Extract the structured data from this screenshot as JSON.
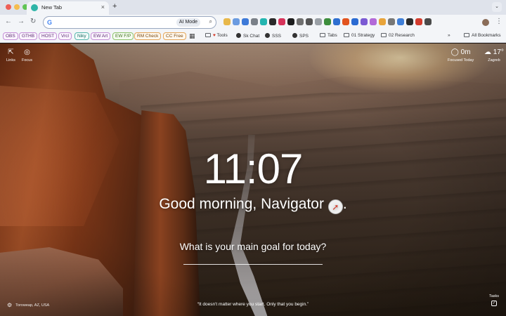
{
  "browser": {
    "tab_title": "New Tab",
    "tab_close": "×",
    "new_tab": "+",
    "tab_menu": "⌄",
    "nav_back": "←",
    "nav_forward": "→",
    "nav_reload": "↻",
    "omnibox_badge": "G",
    "ai_mode": "AI Mode",
    "omnibox_placeholder": "",
    "kebab": "⋮"
  },
  "bookmarks": {
    "chips": [
      "OBS",
      "GTHB",
      "HOST",
      "Vrcl",
      "Niky",
      "EW Art",
      "EW F/P",
      "RM Check",
      "CC Free"
    ],
    "items": [
      "Tools",
      "Sk Chat",
      "SSS",
      "SPS",
      "Tabs",
      "01 Strategy",
      "02 Research"
    ],
    "overflow": "»",
    "all_bookmarks": "All Bookmarks",
    "apps_glyph": "▦"
  },
  "dashboard": {
    "links_label": "Links",
    "focus_label": "Focus",
    "focused_today_value": "0m",
    "focused_today_label": "Focused Today",
    "weather_temp": "17°",
    "weather_city": "Zagreb",
    "clock": "11:07",
    "greeting": "Good morning, Navigator",
    "greeting_end": ".",
    "compass_glyph": "➚",
    "focus_question": "What is your main goal for today?",
    "location": "Toroweap, AZ, USA",
    "quote": "“It doesn't matter where you start. Only that you begin.”",
    "tasks_label": "Tasks",
    "tasks_glyph": "✓"
  },
  "colors": {
    "chrome_bg": "#f3f5f8",
    "tab_strip_bg": "#dfe3eb",
    "accent_blue": "#4285f4"
  }
}
